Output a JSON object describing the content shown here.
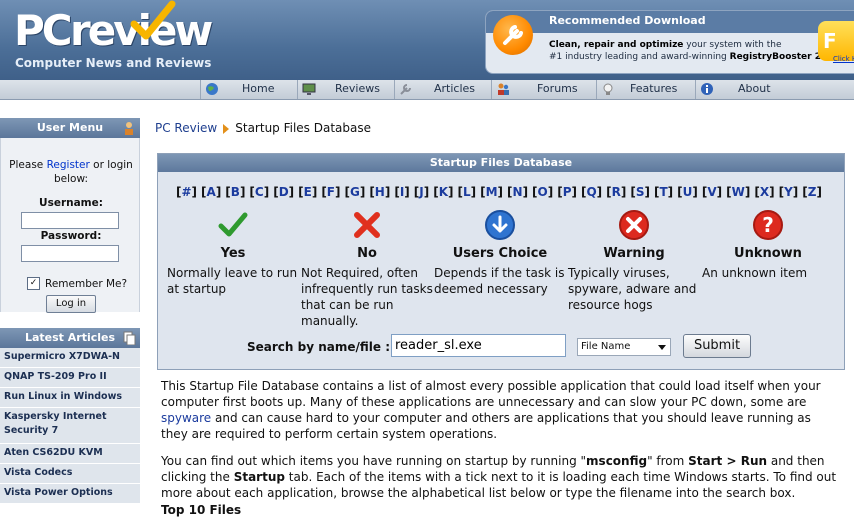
{
  "brand": {
    "logo_pc": "PC",
    "logo_review": "review",
    "tagline": "Computer News and Reviews"
  },
  "ad": {
    "title": "Recommended Download",
    "line1_bold": "Clean, repair and optimize",
    "line1_rest": " your system with the",
    "line2_start": "#1 industry leading and award-winning ",
    "line2_bold": "RegistryBooster 2.",
    "button_label": "F",
    "click_label": "Click H"
  },
  "nav": {
    "items": [
      {
        "label": "Home",
        "icon": "globe-icon"
      },
      {
        "label": "Reviews",
        "icon": "monitor-icon"
      },
      {
        "label": "Articles",
        "icon": "wrench-icon"
      },
      {
        "label": "Forums",
        "icon": "users-icon"
      },
      {
        "label": "Features",
        "icon": "lightbulb-icon"
      },
      {
        "label": "About",
        "icon": "info-icon"
      }
    ]
  },
  "sidebar": {
    "user_menu": {
      "title": "User Menu",
      "please": "Please ",
      "register": "Register",
      "or_login": " or login",
      "below": "below:",
      "username_label": "Username:",
      "password_label": "Password:",
      "remember_label": "Remember Me?",
      "remember_checked": "✓",
      "login_button": "Log in"
    },
    "latest_articles": {
      "title": "Latest Articles",
      "items": [
        "Supermicro X7DWA-N",
        "QNAP TS-209 Pro II",
        "Run Linux in Windows",
        "Kaspersky Internet Security 7",
        "Aten CS62DU KVM",
        "Vista Codecs",
        "Vista Power Options"
      ]
    }
  },
  "breadcrumb": {
    "home": "PC Review",
    "current": "Startup Files Database"
  },
  "database": {
    "title": "Startup Files Database",
    "letters": [
      "#",
      "A",
      "B",
      "C",
      "D",
      "E",
      "F",
      "G",
      "H",
      "I",
      "J",
      "K",
      "L",
      "M",
      "N",
      "O",
      "P",
      "Q",
      "R",
      "S",
      "T",
      "U",
      "V",
      "W",
      "X",
      "Y",
      "Z"
    ],
    "categories": [
      {
        "title": "Yes",
        "desc": "Normally leave to run at startup",
        "icon": "check-icon"
      },
      {
        "title": "No",
        "desc": "Not Required, often infrequently run tasks that can be run manually.",
        "icon": "x-icon"
      },
      {
        "title": "Users Choice",
        "desc": "Depends if the task is deemed necessary",
        "icon": "down-arrow-icon"
      },
      {
        "title": "Warning",
        "desc": "Typically viruses, spyware, adware and resource hogs",
        "icon": "warning-icon"
      },
      {
        "title": "Unknown",
        "desc": "An unknown item",
        "icon": "question-icon"
      }
    ],
    "search": {
      "label": "Search by name/file :",
      "value": "reader_sl.exe",
      "select_value": "File Name",
      "submit_label": "Submit"
    }
  },
  "content": {
    "p1_a": "This Startup File Database contains a list of almost every possible application that could load itself when your computer first boots up. Many of these applications are unnecessary and can slow your PC down, some are ",
    "p1_link": "spyware",
    "p1_b": " and can cause hard to your computer and others are applications that you should leave running as they are required to perform certain system operations.",
    "p2_a": "You can find out which items you have running on startup by running \"",
    "p2_msconfig": "msconfig",
    "p2_b": "\" from ",
    "p2_startrun": "Start > Run",
    "p2_c": " and then clicking the ",
    "p2_startup": "Startup",
    "p2_d": " tab. Each of the items with a tick next to it is loading each time Windows starts. To find out more about each application, browse the alphabetical list below or type the filename into the search box.",
    "top10_title": "Top 10 Files"
  },
  "colors": {
    "header_blue": "#4c6f98",
    "panel_blue": "#5d789c",
    "link_blue": "#1b3b9e",
    "accent_orange": "#ff8a00"
  }
}
